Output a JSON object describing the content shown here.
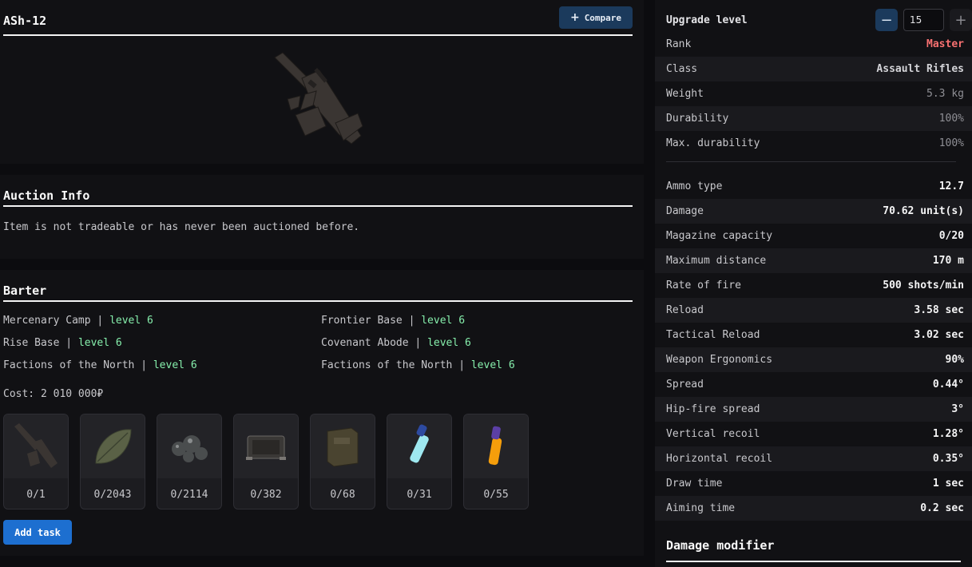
{
  "item": {
    "name": "ASh-12",
    "compare_label": "Compare"
  },
  "auction": {
    "title": "Auction Info",
    "text": "Item is not tradeable or has never been auctioned before."
  },
  "barter": {
    "title": "Barter",
    "traders": [
      {
        "name": "Mercenary Camp",
        "level": "level 6"
      },
      {
        "name": "Frontier Base",
        "level": "level 6"
      },
      {
        "name": "Rise Base",
        "level": "level 6"
      },
      {
        "name": "Covenant Abode",
        "level": "level 6"
      },
      {
        "name": "Factions of the North",
        "level": "level 6"
      },
      {
        "name": "Factions of the North",
        "level": "level 6"
      }
    ],
    "cost": "Cost: 2 010 000₽",
    "items": [
      {
        "icon": "rifle-icon",
        "count": "0/1"
      },
      {
        "icon": "leaf-icon",
        "count": "0/2043"
      },
      {
        "icon": "pebbles-icon",
        "count": "0/2114"
      },
      {
        "icon": "device-icon",
        "count": "0/382"
      },
      {
        "icon": "crate-icon",
        "count": "0/68"
      },
      {
        "icon": "blue-vial-icon",
        "count": "0/31"
      },
      {
        "icon": "orange-vial-icon",
        "count": "0/55"
      }
    ],
    "add_task_label": "Add task"
  },
  "upgrade": {
    "label": "Upgrade level",
    "value": "15"
  },
  "stats_a": [
    {
      "k": "Rank",
      "v": "Master"
    },
    {
      "k": "Class",
      "v": "Assault Rifles"
    },
    {
      "k": "Weight",
      "v": "5.3 kg"
    },
    {
      "k": "Durability",
      "v": "100%"
    },
    {
      "k": "Max. durability",
      "v": "100%"
    }
  ],
  "stats_b": [
    {
      "k": "Ammo type",
      "v": "12.7"
    },
    {
      "k": "Damage",
      "v": "70.62 unit(s)"
    },
    {
      "k": "Magazine capacity",
      "v": "0/20"
    },
    {
      "k": "Maximum distance",
      "v": "170 m"
    },
    {
      "k": "Rate of fire",
      "v": "500 shots/min"
    },
    {
      "k": "Reload",
      "v": "3.58 sec"
    },
    {
      "k": "Tactical Reload",
      "v": "3.02 sec"
    },
    {
      "k": "Weapon Ergonomics",
      "v": "90%"
    },
    {
      "k": "Spread",
      "v": "0.44°"
    },
    {
      "k": "Hip-fire spread",
      "v": "3°"
    },
    {
      "k": "Vertical recoil",
      "v": "1.28°"
    },
    {
      "k": "Horizontal recoil",
      "v": "0.35°"
    },
    {
      "k": "Draw time",
      "v": "1 sec"
    },
    {
      "k": "Aiming time",
      "v": "0.2 sec"
    }
  ],
  "damage_modifier_title": "Damage modifier",
  "colors": {
    "rank": "#f87171",
    "level": "#86efac",
    "accent": "#1d6fd0"
  }
}
